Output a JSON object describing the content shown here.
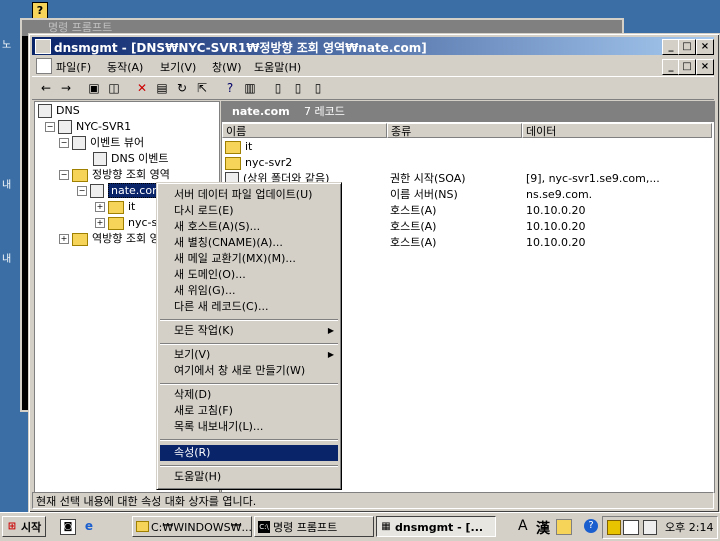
{
  "colors": {
    "title_active": "#0a246a",
    "desktop": "#3a6ea5",
    "face": "#d4d0c8",
    "highlight": "#0a246a"
  },
  "bg_console": {
    "title": "명령 프롬프트"
  },
  "window": {
    "title": "dnsmgmt - [DNS₩NYC-SVR1₩정방향 조회 영역₩nate.com]",
    "controls": {
      "minimize": "_",
      "restore": "□",
      "close": "×"
    }
  },
  "menubar": {
    "items": [
      "파일(F)",
      "동작(A)",
      "보기(V)",
      "창(W)",
      "도움말(H)"
    ],
    "mdi_controls": [
      "_",
      "□",
      "×"
    ]
  },
  "toolbar": {
    "icons": [
      "back-arrow-icon",
      "forward-arrow-icon",
      "up-folder-icon",
      "show-tree-icon",
      "delete-icon",
      "properties-icon",
      "refresh-icon",
      "export-icon",
      "help-icon",
      "console-icon",
      "new-record-icon",
      "new-domain-icon",
      "new-delegation-icon"
    ]
  },
  "tree": {
    "nodes": [
      {
        "label": "DNS",
        "level": 0,
        "pm": ""
      },
      {
        "label": "NYC-SVR1",
        "level": 1,
        "pm": "−"
      },
      {
        "label": "이벤트 뷰어",
        "level": 2,
        "pm": "−"
      },
      {
        "label": "DNS 이벤트",
        "level": 3,
        "pm": ""
      },
      {
        "label": "정방향 조회 영역",
        "level": 2,
        "pm": "−"
      },
      {
        "label": "nate.com",
        "level": 3,
        "pm": "−"
      },
      {
        "label": "it",
        "level": 4,
        "pm": "+"
      },
      {
        "label": "nyc-s",
        "level": 4,
        "pm": "+"
      },
      {
        "label": "역방향 조회 영",
        "level": 2,
        "pm": "+"
      }
    ]
  },
  "right_panel": {
    "zone": "nate.com",
    "record_count": "7 레코드",
    "columns": [
      "이름",
      "종류",
      "데이터"
    ],
    "rows": [
      {
        "name": "it",
        "type": "",
        "data": ""
      },
      {
        "name": "nyc-svr2",
        "type": "",
        "data": ""
      },
      {
        "name": "(상위 폴더와 같음)",
        "type": "권한 시작(SOA)",
        "data": "[9], nyc-svr1.se9.com,..."
      },
      {
        "name": "",
        "type": "이름 서버(NS)",
        "data": "ns.se9.com."
      },
      {
        "name": "",
        "type": "호스트(A)",
        "data": "10.10.0.20"
      },
      {
        "name": "",
        "type": "호스트(A)",
        "data": "10.10.0.20"
      },
      {
        "name": "",
        "type": "호스트(A)",
        "data": "10.10.0.20"
      }
    ]
  },
  "context_menu": {
    "items": [
      {
        "label": "서버 데이터 파일 업데이트(U)",
        "submenu": false
      },
      {
        "label": "다시 로드(E)",
        "submenu": false
      },
      {
        "label": "새 호스트(A)(S)...",
        "submenu": false
      },
      {
        "label": "새 별칭(CNAME)(A)...",
        "submenu": false
      },
      {
        "label": "새 메일 교환기(MX)(M)...",
        "submenu": false
      },
      {
        "label": "새 도메인(O)...",
        "submenu": false
      },
      {
        "label": "새 위임(G)...",
        "submenu": false
      },
      {
        "label": "다른 새 레코드(C)...",
        "submenu": false
      },
      {
        "sep": true
      },
      {
        "label": "모든 작업(K)",
        "submenu": true
      },
      {
        "sep": true
      },
      {
        "label": "보기(V)",
        "submenu": true
      },
      {
        "label": "여기에서 창 새로 만들기(W)",
        "submenu": false
      },
      {
        "sep": true
      },
      {
        "label": "삭제(D)",
        "submenu": false
      },
      {
        "label": "새로 고침(F)",
        "submenu": false
      },
      {
        "label": "목록 내보내기(L)...",
        "submenu": false
      },
      {
        "sep": true
      },
      {
        "label": "속성(R)",
        "submenu": false,
        "highlighted": true
      },
      {
        "sep": true
      },
      {
        "label": "도움말(H)",
        "submenu": false
      }
    ]
  },
  "status_text": "현재 선택 내용에 대한 속성 대화 상자를 엽니다.",
  "taskbar": {
    "start_label": "시작",
    "buttons": [
      {
        "label": "C:₩WINDOWS₩...",
        "pressed": false
      },
      {
        "label": "명령 프롬프트",
        "pressed": false
      },
      {
        "label": "dnsmgmt - [...",
        "pressed": true
      }
    ],
    "ime": [
      "A",
      "漢"
    ],
    "clock": "오후 2:14"
  }
}
